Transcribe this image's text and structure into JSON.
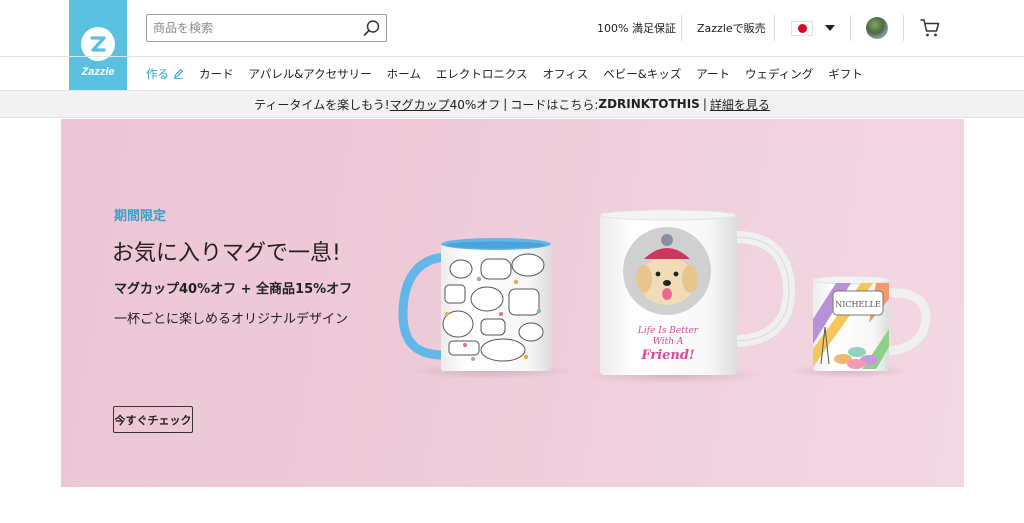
{
  "brand": {
    "name": "Zazzle",
    "accent": "#5bbfe0"
  },
  "search": {
    "placeholder": "商品を検索",
    "value": ""
  },
  "header": {
    "guarantee": "100% 満足保証",
    "sell": "Zazzleで販売",
    "flag_icon": "japan-flag-icon",
    "cart_icon": "cart-icon"
  },
  "nav": {
    "create": "作る",
    "items": [
      "カード",
      "アパレル&アクセサリー",
      "ホーム",
      "エレクトロニクス",
      "オフィス",
      "ベビー&キッズ",
      "アート",
      "ウェディング",
      "ギフト"
    ]
  },
  "promo": {
    "lead": "ティータイムを楽しもう!",
    "link": "マグカップ",
    "discount": "40%オフ",
    "code_label": "コードはこちら: ",
    "code": "ZDRINKTOTHIS",
    "details": "詳細を見る"
  },
  "hero": {
    "eyebrow": "期間限定",
    "title": "お気に入りマグで一息!",
    "subtitle": "マグカップ40%オフ + 全商品15%オフ",
    "description": "一杯ごとに楽しめるオリジナルデザイン",
    "cta": "今すぐチェック",
    "mug2_text": [
      "Life Is Better",
      "With A",
      "Friend!"
    ],
    "mug3_text": "NICHELLE"
  },
  "colors": {
    "hero_bg": "#eec9d7",
    "eyebrow": "#3a9fc9",
    "nav_active": "#2a9fd6"
  }
}
